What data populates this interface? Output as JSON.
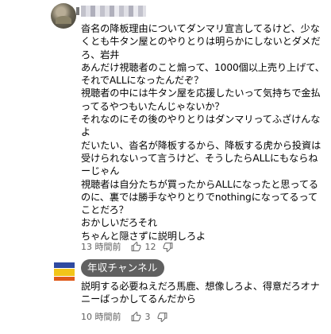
{
  "comments": [
    {
      "body": "沓名の降板理由についてダンマリ宣言してるけど、少なくとも牛タン屋とのやりとりは明らかにしないとダメだろ、岩井\nあんだけ視聴者のこと煽って、1000個以上売り上げて、それでALLになったんだぞ？\n視聴者の中には牛タン屋を応援したいって気持ちで金払ってるやつもいたんじゃないか？\nそれなのにその後のやりとりはダンマリってふざけんなよ\nだいたい、沓名が降板するから、降板する虎から投資は受けられないって言うけど、そうしたらALLにもならねーじゃん\n視聴者は自分たちが買ったからALLになったと思ってるのに、裏では勝手なやりとりでnothingになってるってことだろ？\nおかしいだろそれ\nちゃんと隠さずに説明しろよ",
      "time": "13 時間前",
      "likes": "12",
      "reply_label": ""
    },
    {
      "author": "年収チャンネル",
      "body": "説明する必要ねえだろ馬鹿、想像しろよ、得意だろオナニーばっかしてるんだから",
      "time": "10 時間前",
      "likes": "3",
      "reply_label": ""
    }
  ],
  "icons": {
    "like": "thumbs-up-icon",
    "dislike": "thumbs-down-icon"
  },
  "colors": {
    "meta_text": "#606060",
    "badge_bg": "#606060",
    "text": "#030303"
  }
}
